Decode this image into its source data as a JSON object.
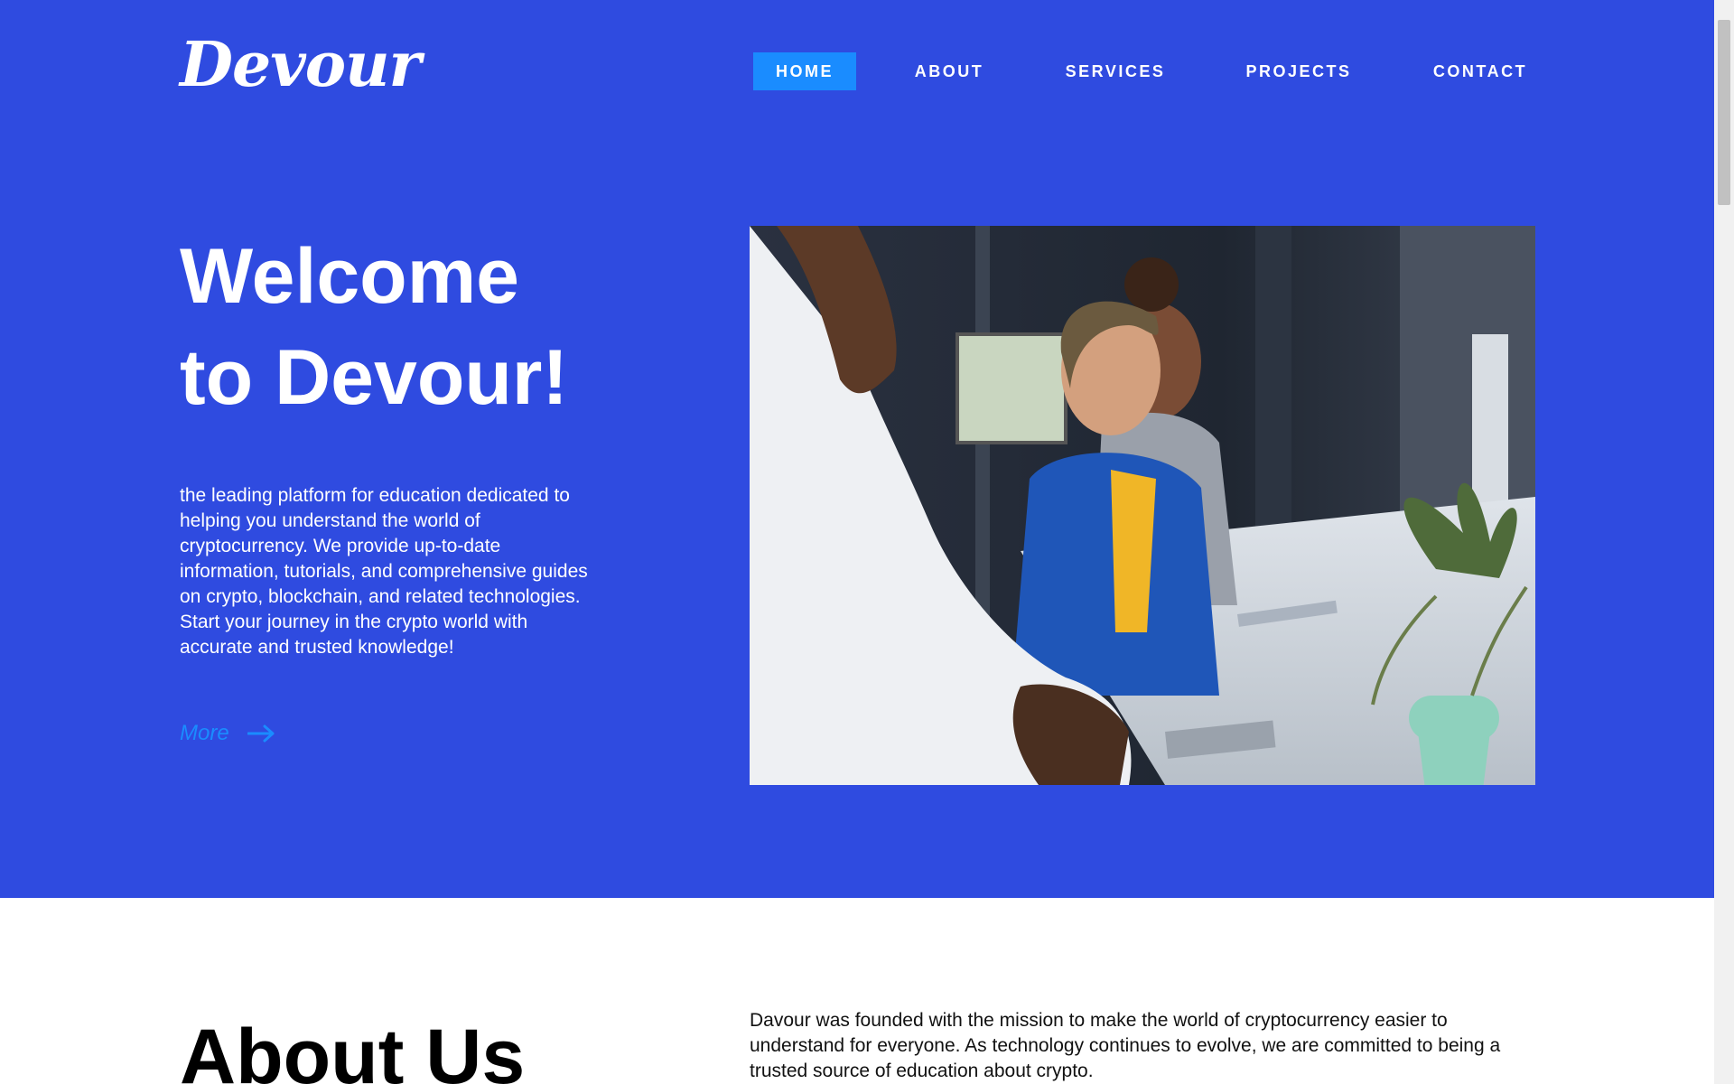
{
  "header": {
    "logo": "Devour",
    "nav": [
      {
        "label": "HOME",
        "active": true
      },
      {
        "label": "ABOUT",
        "active": false
      },
      {
        "label": "SERVICES",
        "active": false
      },
      {
        "label": "PROJECTS",
        "active": false
      },
      {
        "label": "CONTACT",
        "active": false
      }
    ]
  },
  "hero": {
    "title_line1": "Welcome",
    "title_line2": "to Devour!",
    "description": "the leading platform for education dedicated to helping you understand the world of cryptocurrency. We provide up-to-date information, tutorials, and comprehensive guides on crypto, blockchain, and related technologies. Start your journey in the crypto world with accurate and trusted knowledge!",
    "more_label": "More",
    "more_icon": "arrow-right-icon",
    "image_alt": "office team working at laptops"
  },
  "about": {
    "title": "About Us",
    "text": "Davour was founded with the mission to make the world of cryptocurrency easier to understand for everyone. As technology continues to evolve, we are committed to being a trusted source of education about crypto."
  },
  "colors": {
    "hero_bg": "#2f4be0",
    "accent": "#1a8cff",
    "text_light": "#ffffff",
    "text_dark": "#000000"
  }
}
